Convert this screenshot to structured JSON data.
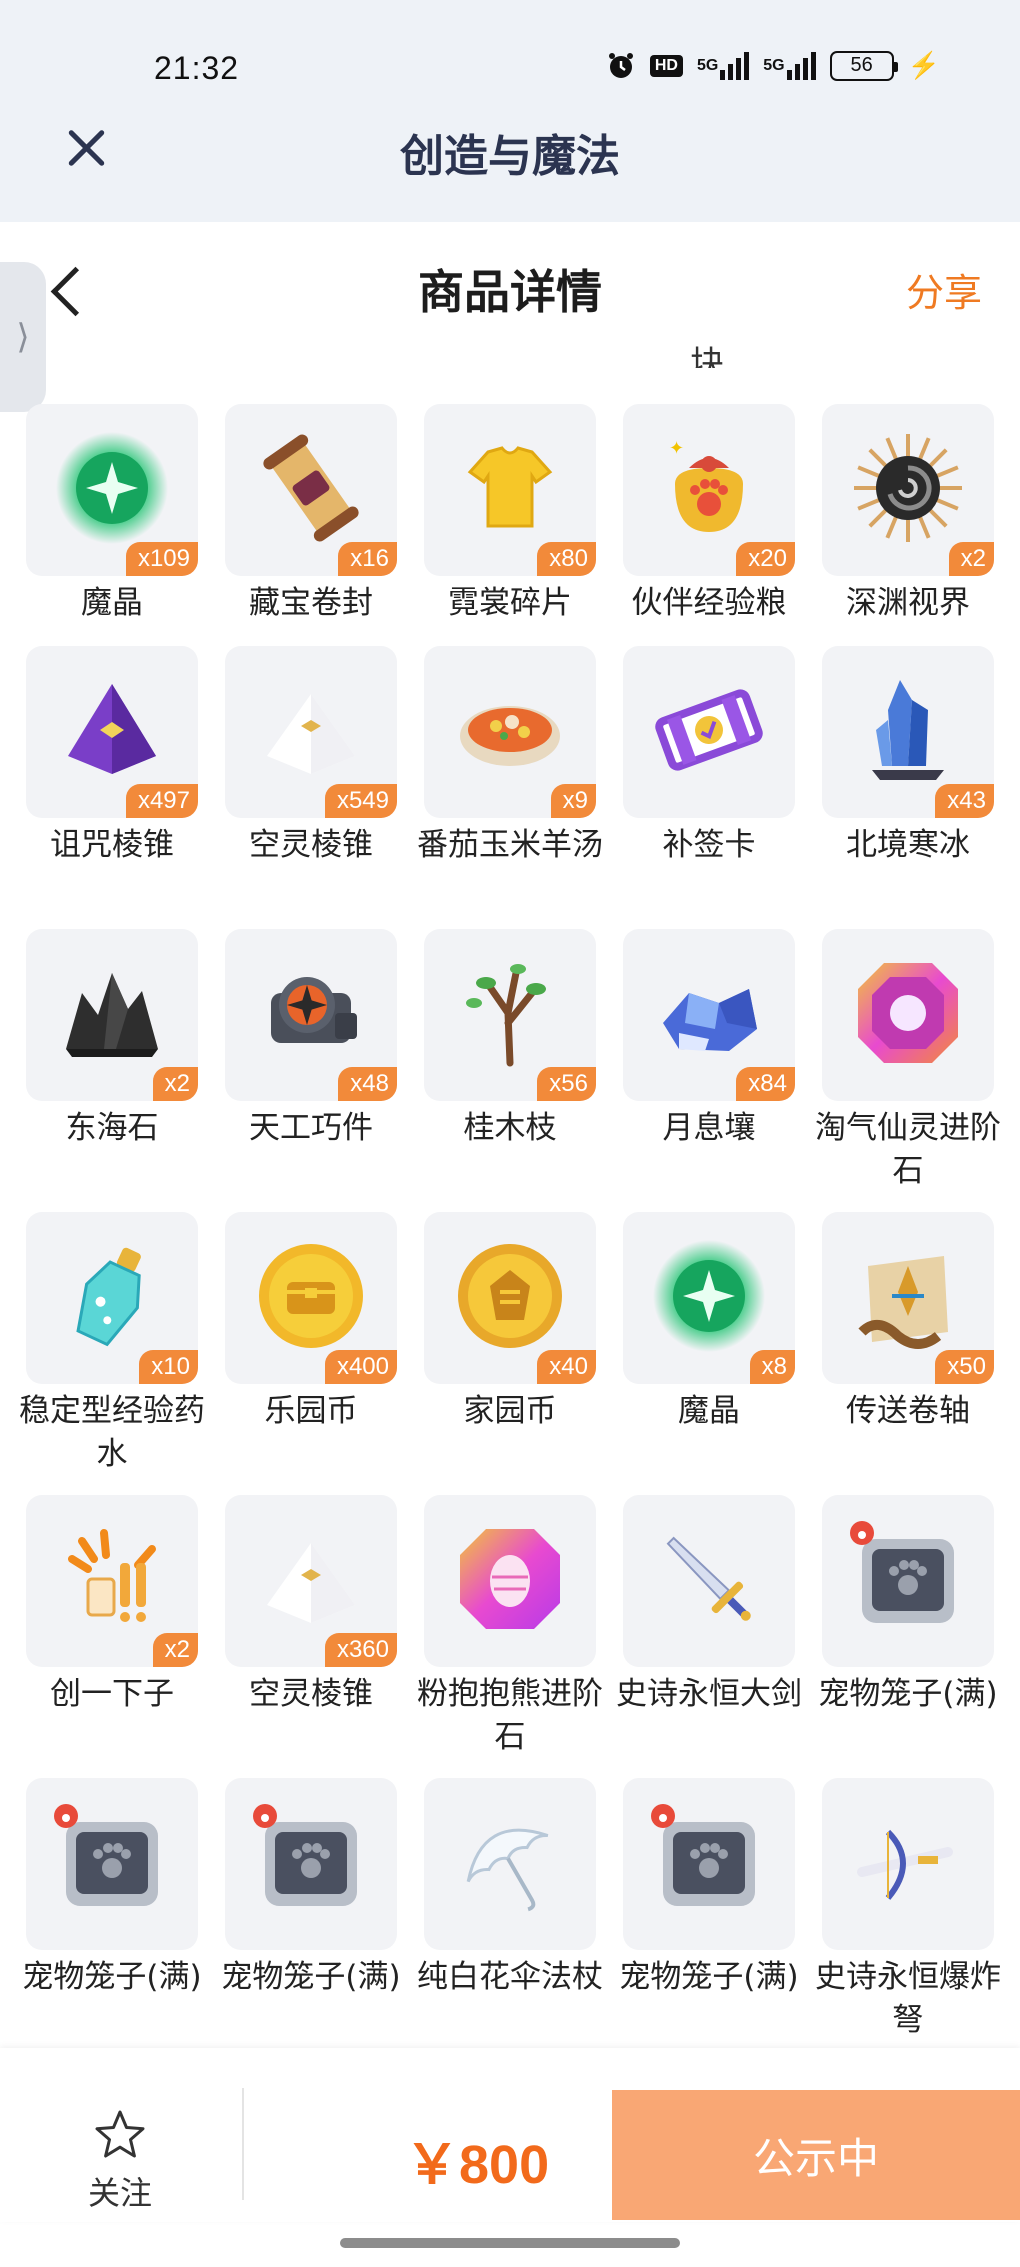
{
  "status": {
    "time": "21:32",
    "battery": "56",
    "network_1": "5G",
    "network_2": "5G",
    "hd": "HD"
  },
  "app": {
    "title": "创造与魔法"
  },
  "page": {
    "title": "商品详情",
    "share_label": "分享",
    "cut_text": "块"
  },
  "items": [
    {
      "name": "魔晶",
      "qty": "x109",
      "icon": "green-crystal-orb-icon"
    },
    {
      "name": "藏宝卷封",
      "qty": "x16",
      "icon": "treasure-scroll-icon"
    },
    {
      "name": "霓裳碎片",
      "qty": "x80",
      "icon": "yellow-shirt-icon"
    },
    {
      "name": "伙伴经验粮",
      "qty": "x20",
      "icon": "paw-food-bag-icon"
    },
    {
      "name": "深渊视界",
      "qty": "x2",
      "icon": "abyss-vortex-icon"
    },
    {
      "name": "诅咒棱锥",
      "qty": "x497",
      "icon": "purple-pyramid-icon"
    },
    {
      "name": "空灵棱锥",
      "qty": "x549",
      "icon": "white-pyramid-icon"
    },
    {
      "name": "番茄玉米羊汤",
      "qty": "x9",
      "icon": "soup-bowl-icon"
    },
    {
      "name": "补签卡",
      "qty": "",
      "icon": "purple-ticket-icon"
    },
    {
      "name": "北境寒冰",
      "qty": "x43",
      "icon": "blue-ice-crystal-icon"
    },
    {
      "name": "东海石",
      "qty": "x2",
      "icon": "black-rock-icon"
    },
    {
      "name": "天工巧件",
      "qty": "x48",
      "icon": "mechanical-part-icon"
    },
    {
      "name": "桂木枝",
      "qty": "x56",
      "icon": "tree-branch-icon"
    },
    {
      "name": "月息壤",
      "qty": "x84",
      "icon": "blue-soil-icon"
    },
    {
      "name": "淘气仙灵进阶石",
      "qty": "",
      "icon": "rainbow-gem-icon"
    },
    {
      "name": "稳定型经验药水",
      "qty": "x10",
      "icon": "potion-bottle-icon"
    },
    {
      "name": "乐园币",
      "qty": "x400",
      "icon": "gold-coin-chest-icon"
    },
    {
      "name": "家园币",
      "qty": "x40",
      "icon": "gold-coin-emblem-icon"
    },
    {
      "name": "魔晶",
      "qty": "x8",
      "icon": "green-crystal-orb-icon"
    },
    {
      "name": "传送卷轴",
      "qty": "x50",
      "icon": "teleport-scroll-icon"
    },
    {
      "name": "创一下子",
      "qty": "x2",
      "icon": "exclaim-burst-icon"
    },
    {
      "name": "空灵棱锥",
      "qty": "x360",
      "icon": "white-pyramid-icon"
    },
    {
      "name": "粉抱抱熊进阶石",
      "qty": "",
      "icon": "pink-egg-gem-icon"
    },
    {
      "name": "史诗永恒大剑",
      "qty": "",
      "icon": "great-sword-icon"
    },
    {
      "name": "宠物笼子(满)",
      "qty": "",
      "icon": "pet-cage-icon"
    },
    {
      "name": "宠物笼子(满)",
      "qty": "",
      "icon": "pet-cage-icon"
    },
    {
      "name": "宠物笼子(满)",
      "qty": "",
      "icon": "pet-cage-icon"
    },
    {
      "name": "纯白花伞法杖",
      "qty": "",
      "icon": "white-umbrella-icon"
    },
    {
      "name": "宠物笼子(满)",
      "qty": "",
      "icon": "pet-cage-icon"
    },
    {
      "name": "史诗永恒爆炸弩",
      "qty": "",
      "icon": "crossbow-icon"
    }
  ],
  "bottom": {
    "follow_label": "关注",
    "price": "￥800",
    "status_button": "公示中"
  },
  "colors": {
    "accent": "#ef7a22",
    "price": "#f26a1b",
    "button": "#f9a774",
    "badge": "#f28a3a"
  }
}
